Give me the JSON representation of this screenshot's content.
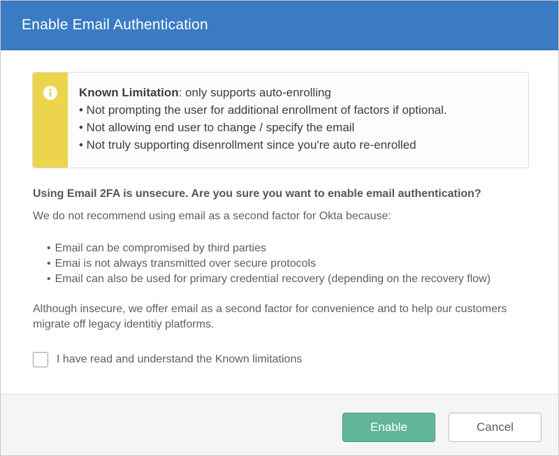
{
  "dialog": {
    "title": "Enable Email Authentication"
  },
  "callout": {
    "icon": "info-icon",
    "accent_color": "#ecd44c",
    "heading_bold": "Known Limitation",
    "heading_rest": ": only supports auto-enrolling",
    "items": [
      "• Not prompting the user for additional enrollment of factors if optional.",
      "• Not allowing end user to change / specify the email",
      "• Not truly supporting disenrollment since you're auto re-enrolled"
    ]
  },
  "warning": {
    "heading": "Using Email 2FA is unsecure. Are you sure you want to enable email authentication?",
    "intro": "We do not recommend using email as a second factor for Okta because:",
    "reasons": [
      "Email can be compromised by third parties",
      "Emai is not always transmitted over secure protocols",
      "Email can also be used for primary credential recovery (depending on the recovery flow)"
    ],
    "conclusion": "Although insecure, we offer email as a second factor for convenience and to help our customers migrate off legacy identitiy platforms."
  },
  "acknowledgement": {
    "label": "I have read and understand the Known limitations",
    "checked": false
  },
  "footer": {
    "enable_label": "Enable",
    "cancel_label": "Cancel"
  },
  "colors": {
    "header": "#3a7bc4",
    "enable_button": "#62b79a"
  }
}
